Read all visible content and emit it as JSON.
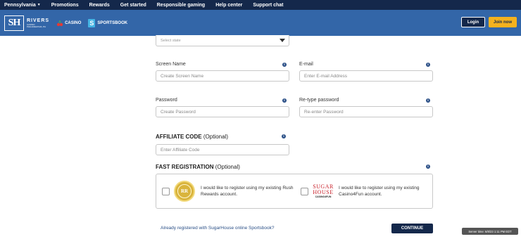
{
  "topnav": {
    "items": [
      {
        "label": "Pennsylvania",
        "has_dropdown": true
      },
      {
        "label": "Promotions"
      },
      {
        "label": "Rewards"
      },
      {
        "label": "Get started"
      },
      {
        "label": "Responsible gaming"
      },
      {
        "label": "Help center"
      },
      {
        "label": "Support chat"
      }
    ]
  },
  "header": {
    "logo_text": "SH",
    "rivers_text": "RIVERS",
    "rivers_sub1": "CASINO",
    "rivers_sub2": "PHILADELPHIA, PA",
    "casino_label": "CASINO",
    "sportsbook_badge": "S",
    "sportsbook_label": "SPORTSBOOK",
    "login_label": "Login",
    "join_label": "Join now"
  },
  "form": {
    "state_placeholder": "Select state",
    "screen_name": {
      "label": "Screen Name",
      "placeholder": "Create Screen Name"
    },
    "email": {
      "label": "E-mail",
      "placeholder": "Enter E-mail Address"
    },
    "password": {
      "label": "Password",
      "placeholder": "Create Password"
    },
    "retype_password": {
      "label": "Re-type password",
      "placeholder": "Re-enter Password"
    },
    "affiliate": {
      "title": "AFFILIATE CODE",
      "optional": "(Optional)",
      "placeholder": "Enter Affiliate Code"
    },
    "fast_registration": {
      "title": "FAST REGISTRATION",
      "optional": "(Optional)",
      "rush_rewards_logo": "RR",
      "rush_rewards_text": "I would like to register using my existing Rush Rewards account.",
      "c4f_logo_line1": "SUGAR",
      "c4f_logo_line2": "HOUSE",
      "c4f_logo_line3": "CASINO4FUN",
      "casino4fun_text": "I would like to register using my existing Casino4Fun account."
    },
    "info_glyph": "i",
    "already_registered_link": "Already registered with SugarHouse online Sportsbook?",
    "continue_label": "CONTINUE"
  },
  "server_time": "Server time: 6/8/23 1:11 PM EDT",
  "colors": {
    "nav_bg": "#14284b",
    "header_bg": "#3366a8",
    "join_bg": "#f5b21e",
    "info_icon": "#2a4f86"
  }
}
